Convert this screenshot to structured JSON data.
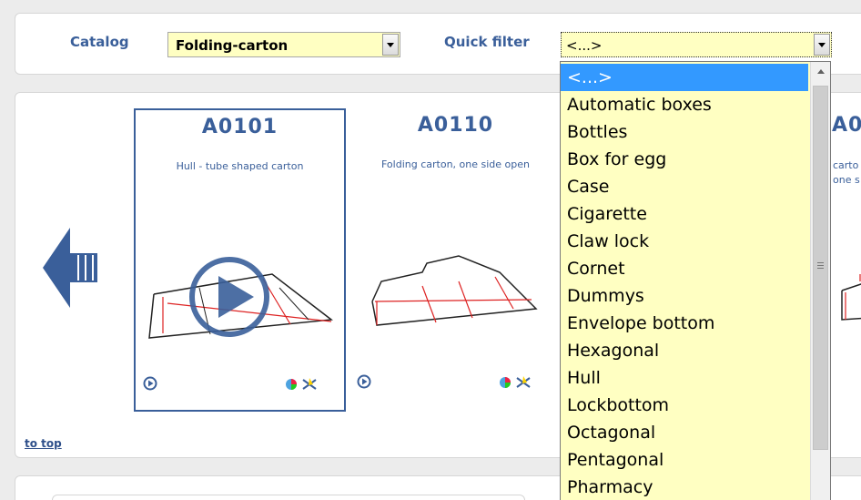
{
  "filter": {
    "catalog_label": "Catalog",
    "catalog_value": "Folding-carton",
    "quick_label": "Quick filter",
    "quick_value": "<...>"
  },
  "cards": [
    {
      "code": "A0101",
      "desc": "Hull - tube shaped carton"
    },
    {
      "code": "A0110",
      "desc": "Folding carton, one side open"
    },
    {
      "code": "A0",
      "desc": "carto\none s"
    }
  ],
  "to_top": "to top",
  "dropdown": {
    "selected": "<...>",
    "items": [
      "<...>",
      "Automatic boxes",
      "Bottles",
      "Box for egg",
      "Case",
      "Cigarette",
      "Claw lock",
      "Cornet",
      "Dummys",
      "Envelope bottom",
      "Hexagonal",
      "Hull",
      "Lockbottom",
      "Octagonal",
      "Pentagonal",
      "Pharmacy"
    ]
  },
  "colors": {
    "accent": "#3a5f9a",
    "select_bg": "#ffffc2",
    "highlight": "#3399ff"
  },
  "icons": [
    "prev-arrow-icon",
    "play-overlay-icon",
    "play-small-icon",
    "color-wheel-icon",
    "tools-icon"
  ]
}
